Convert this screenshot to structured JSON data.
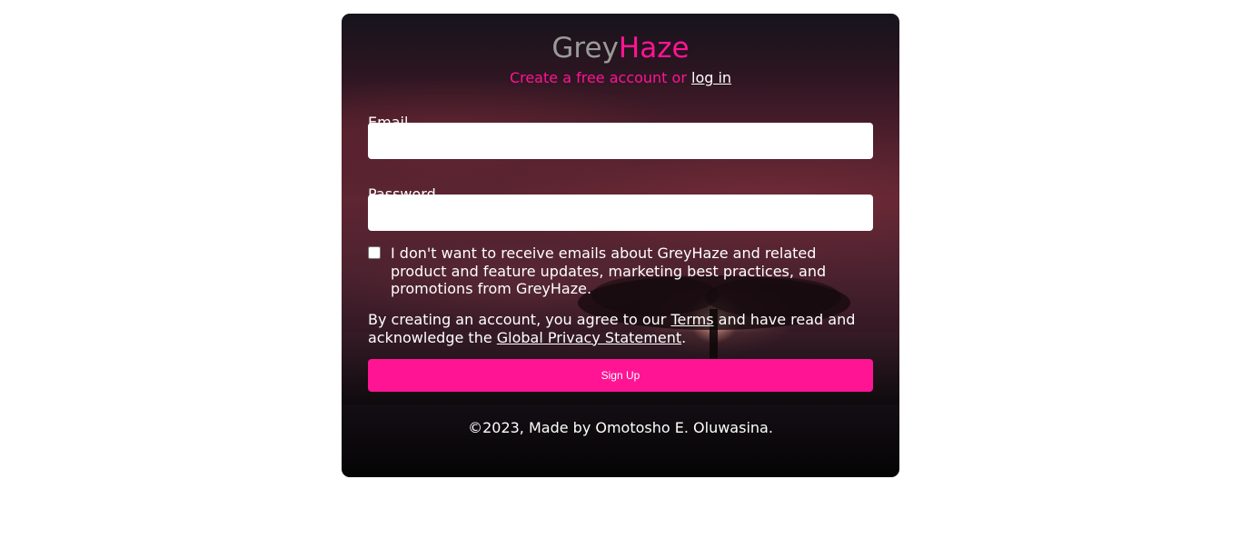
{
  "brand": {
    "part1": "Grey",
    "part2": "Haze",
    "part1_color": "#9a9a9a",
    "part2_color": "#ff1493"
  },
  "subtitle": {
    "text": "Create a free account or ",
    "login_link": "log in"
  },
  "form": {
    "email_label": "Email",
    "email_value": "",
    "password_label": "Password",
    "password_value": "",
    "consent_checked": false,
    "consent_text": "I don't want to receive emails about GreyHaze and related product and feature updates, marketing best practices, and promotions from GreyHaze.",
    "terms_prefix": "By creating an account, you agree to our ",
    "terms_link": "Terms",
    "terms_middle": " and have read and acknowledge the ",
    "privacy_link": "Global Privacy Statement",
    "terms_suffix": ".",
    "submit_label": "Sign Up"
  },
  "footer": {
    "text": "©2023, Made by Omotosho E. Oluwasina."
  },
  "colors": {
    "accent": "#ff1493",
    "page_background": "#ffffff"
  }
}
